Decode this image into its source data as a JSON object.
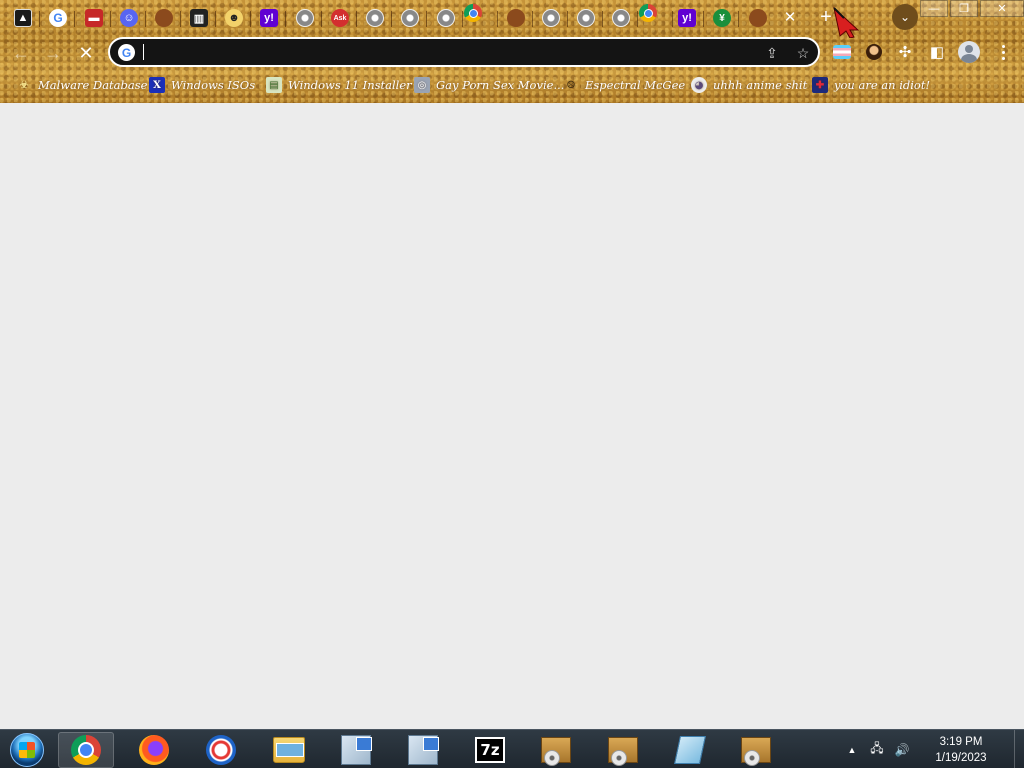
{
  "window": {
    "minimize_glyph": "—",
    "restore_glyph": "❐",
    "close_glyph": "✕"
  },
  "tabs": [
    {
      "icon": "cursor-icon",
      "glyph": "▲"
    },
    {
      "icon": "google-icon",
      "glyph": "G"
    },
    {
      "icon": "red-page-icon",
      "glyph": "▬"
    },
    {
      "icon": "discord-icon",
      "glyph": "☺"
    },
    {
      "icon": "person-icon",
      "glyph": ""
    },
    {
      "icon": "museum-icon",
      "glyph": "▥"
    },
    {
      "icon": "smiley-icon",
      "glyph": "☻"
    },
    {
      "icon": "yahoo-icon",
      "glyph": "y!"
    },
    {
      "icon": "globe-icon",
      "glyph": ""
    },
    {
      "icon": "ask-icon",
      "glyph": "Ask"
    },
    {
      "icon": "globe-icon",
      "glyph": ""
    },
    {
      "icon": "globe-icon",
      "glyph": ""
    },
    {
      "icon": "globe-icon",
      "glyph": ""
    },
    {
      "icon": "chrome-icon",
      "glyph": ""
    },
    {
      "icon": "character-icon",
      "glyph": ""
    },
    {
      "icon": "globe-icon",
      "glyph": ""
    },
    {
      "icon": "globe-icon",
      "glyph": ""
    },
    {
      "icon": "globe-icon",
      "glyph": ""
    },
    {
      "icon": "chrome-icon",
      "glyph": ""
    },
    {
      "icon": "yahoo-icon",
      "glyph": "y!"
    },
    {
      "icon": "green-download-icon",
      "glyph": "¥"
    },
    {
      "icon": "character-icon",
      "glyph": ""
    }
  ],
  "tabstrip": {
    "close_glyph": "✕",
    "new_tab_glyph": "+",
    "search_tabs_glyph": "⌄"
  },
  "toolbar": {
    "back_glyph": "←",
    "forward_glyph": "→",
    "stop_glyph": "✕",
    "omnibox_value": "",
    "omnibox_placeholder": "",
    "google_glyph": "G",
    "share_glyph": "⇪",
    "star_glyph": "☆",
    "extensions_glyph": "✣",
    "sidepanel_glyph": "◧"
  },
  "bookmarks": [
    {
      "label": "Malware Database",
      "icon": "malware-icon",
      "glyph": "☣",
      "color": "#6b4f12"
    },
    {
      "label": "Windows ISOs",
      "icon": "x-logo-icon",
      "glyph": "X",
      "color": "#1a2fb8"
    },
    {
      "label": "Windows 11 Installer",
      "icon": "installer-icon",
      "glyph": "▤",
      "color": "#d8e6c2"
    },
    {
      "label": "Gay Porn Sex Movie...",
      "icon": "disc-icon",
      "glyph": "◎",
      "color": "#9aa4b4"
    },
    {
      "label": "Espectral McGee",
      "icon": "face-icon",
      "glyph": "☹",
      "color": "#8a6a3a"
    },
    {
      "label": "uhhh anime shit",
      "icon": "anime-icon",
      "glyph": "◕",
      "color": "#5a4a7a"
    },
    {
      "label": "you are an idiot!",
      "icon": "uk-flag-icon",
      "glyph": "✚",
      "color": "#b0233a"
    }
  ],
  "taskbar": {
    "apps": [
      {
        "name": "start-orb",
        "icon": "windows-logo-icon"
      },
      {
        "name": "taskbar-chrome",
        "icon": "chrome-icon"
      },
      {
        "name": "taskbar-firefox",
        "icon": "firefox-icon"
      },
      {
        "name": "taskbar-opera",
        "icon": "opera-icon"
      },
      {
        "name": "taskbar-explorer",
        "icon": "folder-icon"
      },
      {
        "name": "taskbar-setup-1",
        "icon": "setup-icon"
      },
      {
        "name": "taskbar-setup-2",
        "icon": "setup-icon"
      },
      {
        "name": "taskbar-7zip",
        "icon": "7zip-icon",
        "label": "7z"
      },
      {
        "name": "taskbar-installer-1",
        "icon": "package-icon"
      },
      {
        "name": "taskbar-installer-2",
        "icon": "package-icon"
      },
      {
        "name": "taskbar-notepad",
        "icon": "notepad-icon"
      },
      {
        "name": "taskbar-installer-3",
        "icon": "package-icon"
      }
    ],
    "tray": {
      "overflow_glyph": "▲",
      "network_glyph": "🖧",
      "volume_glyph": "🔊",
      "time": "3:19 PM",
      "date": "1/19/2023"
    }
  },
  "colors": {
    "theme_gold": "#b8862e",
    "page_bg": "#ececec",
    "omnibox_bg": "#141414"
  }
}
